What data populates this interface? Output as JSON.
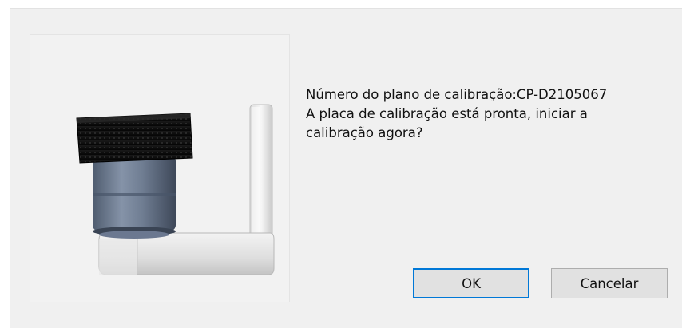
{
  "dialog": {
    "illustration": "calibration-device-image",
    "message_lines": [
      "Número do plano de calibração:CP-D2105067",
      "A placa de calibração está pronta, iniciar a",
      "calibração agora?"
    ],
    "ok_label": "OK",
    "cancel_label": "Cancelar",
    "colors": {
      "background": "#f0f0f0",
      "button": "#e1e1e1",
      "focus_border": "#0078d7"
    }
  }
}
